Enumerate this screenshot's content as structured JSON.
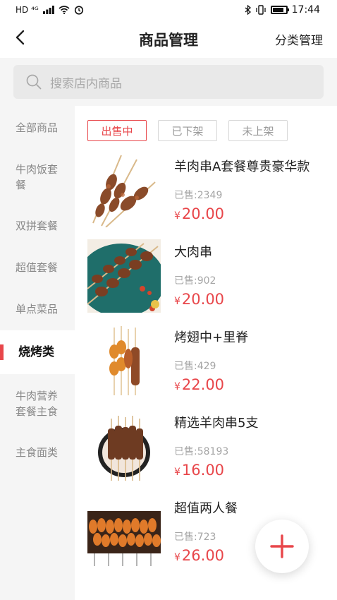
{
  "status_bar": {
    "left": "HD ⁴ᴳ",
    "time": "17:44",
    "battery_level": 0.85
  },
  "header": {
    "back_icon": "chevron-left-icon",
    "title": "商品管理",
    "right_action": "分类管理"
  },
  "search": {
    "placeholder": "搜索店内商品",
    "icon": "search-icon"
  },
  "sidebar": {
    "items": [
      {
        "label": "全部商品"
      },
      {
        "label": "牛肉饭套餐"
      },
      {
        "label": "双拼套餐"
      },
      {
        "label": "超值套餐"
      },
      {
        "label": "单点菜品"
      },
      {
        "label": "烧烤类",
        "active": true
      },
      {
        "label": "牛肉营养套餐主食"
      },
      {
        "label": "主食面类"
      }
    ]
  },
  "filters": {
    "tabs": [
      {
        "label": "出售中",
        "active": true
      },
      {
        "label": "已下架"
      },
      {
        "label": "未上架"
      }
    ]
  },
  "products": [
    {
      "name": "羊肉串A套餐尊贵豪华款",
      "sold": "已售:2349",
      "currency": "¥",
      "price": "20.00"
    },
    {
      "name": "大肉串",
      "sold": "已售:902",
      "currency": "¥",
      "price": "20.00"
    },
    {
      "name": "烤翅中+里脊",
      "sold": "已售:429",
      "currency": "¥",
      "price": "22.00"
    },
    {
      "name": "精选羊肉串5支",
      "sold": "已售:58193",
      "currency": "¥",
      "price": "16.00"
    },
    {
      "name": "超值两人餐",
      "sold": "已售:723",
      "currency": "¥",
      "price": "26.00"
    }
  ],
  "fab": {
    "icon": "plus-icon"
  },
  "colors": {
    "accent": "#e8464a",
    "sidebar_bg": "#f5f5f5",
    "muted_text": "#a5a5a5"
  }
}
